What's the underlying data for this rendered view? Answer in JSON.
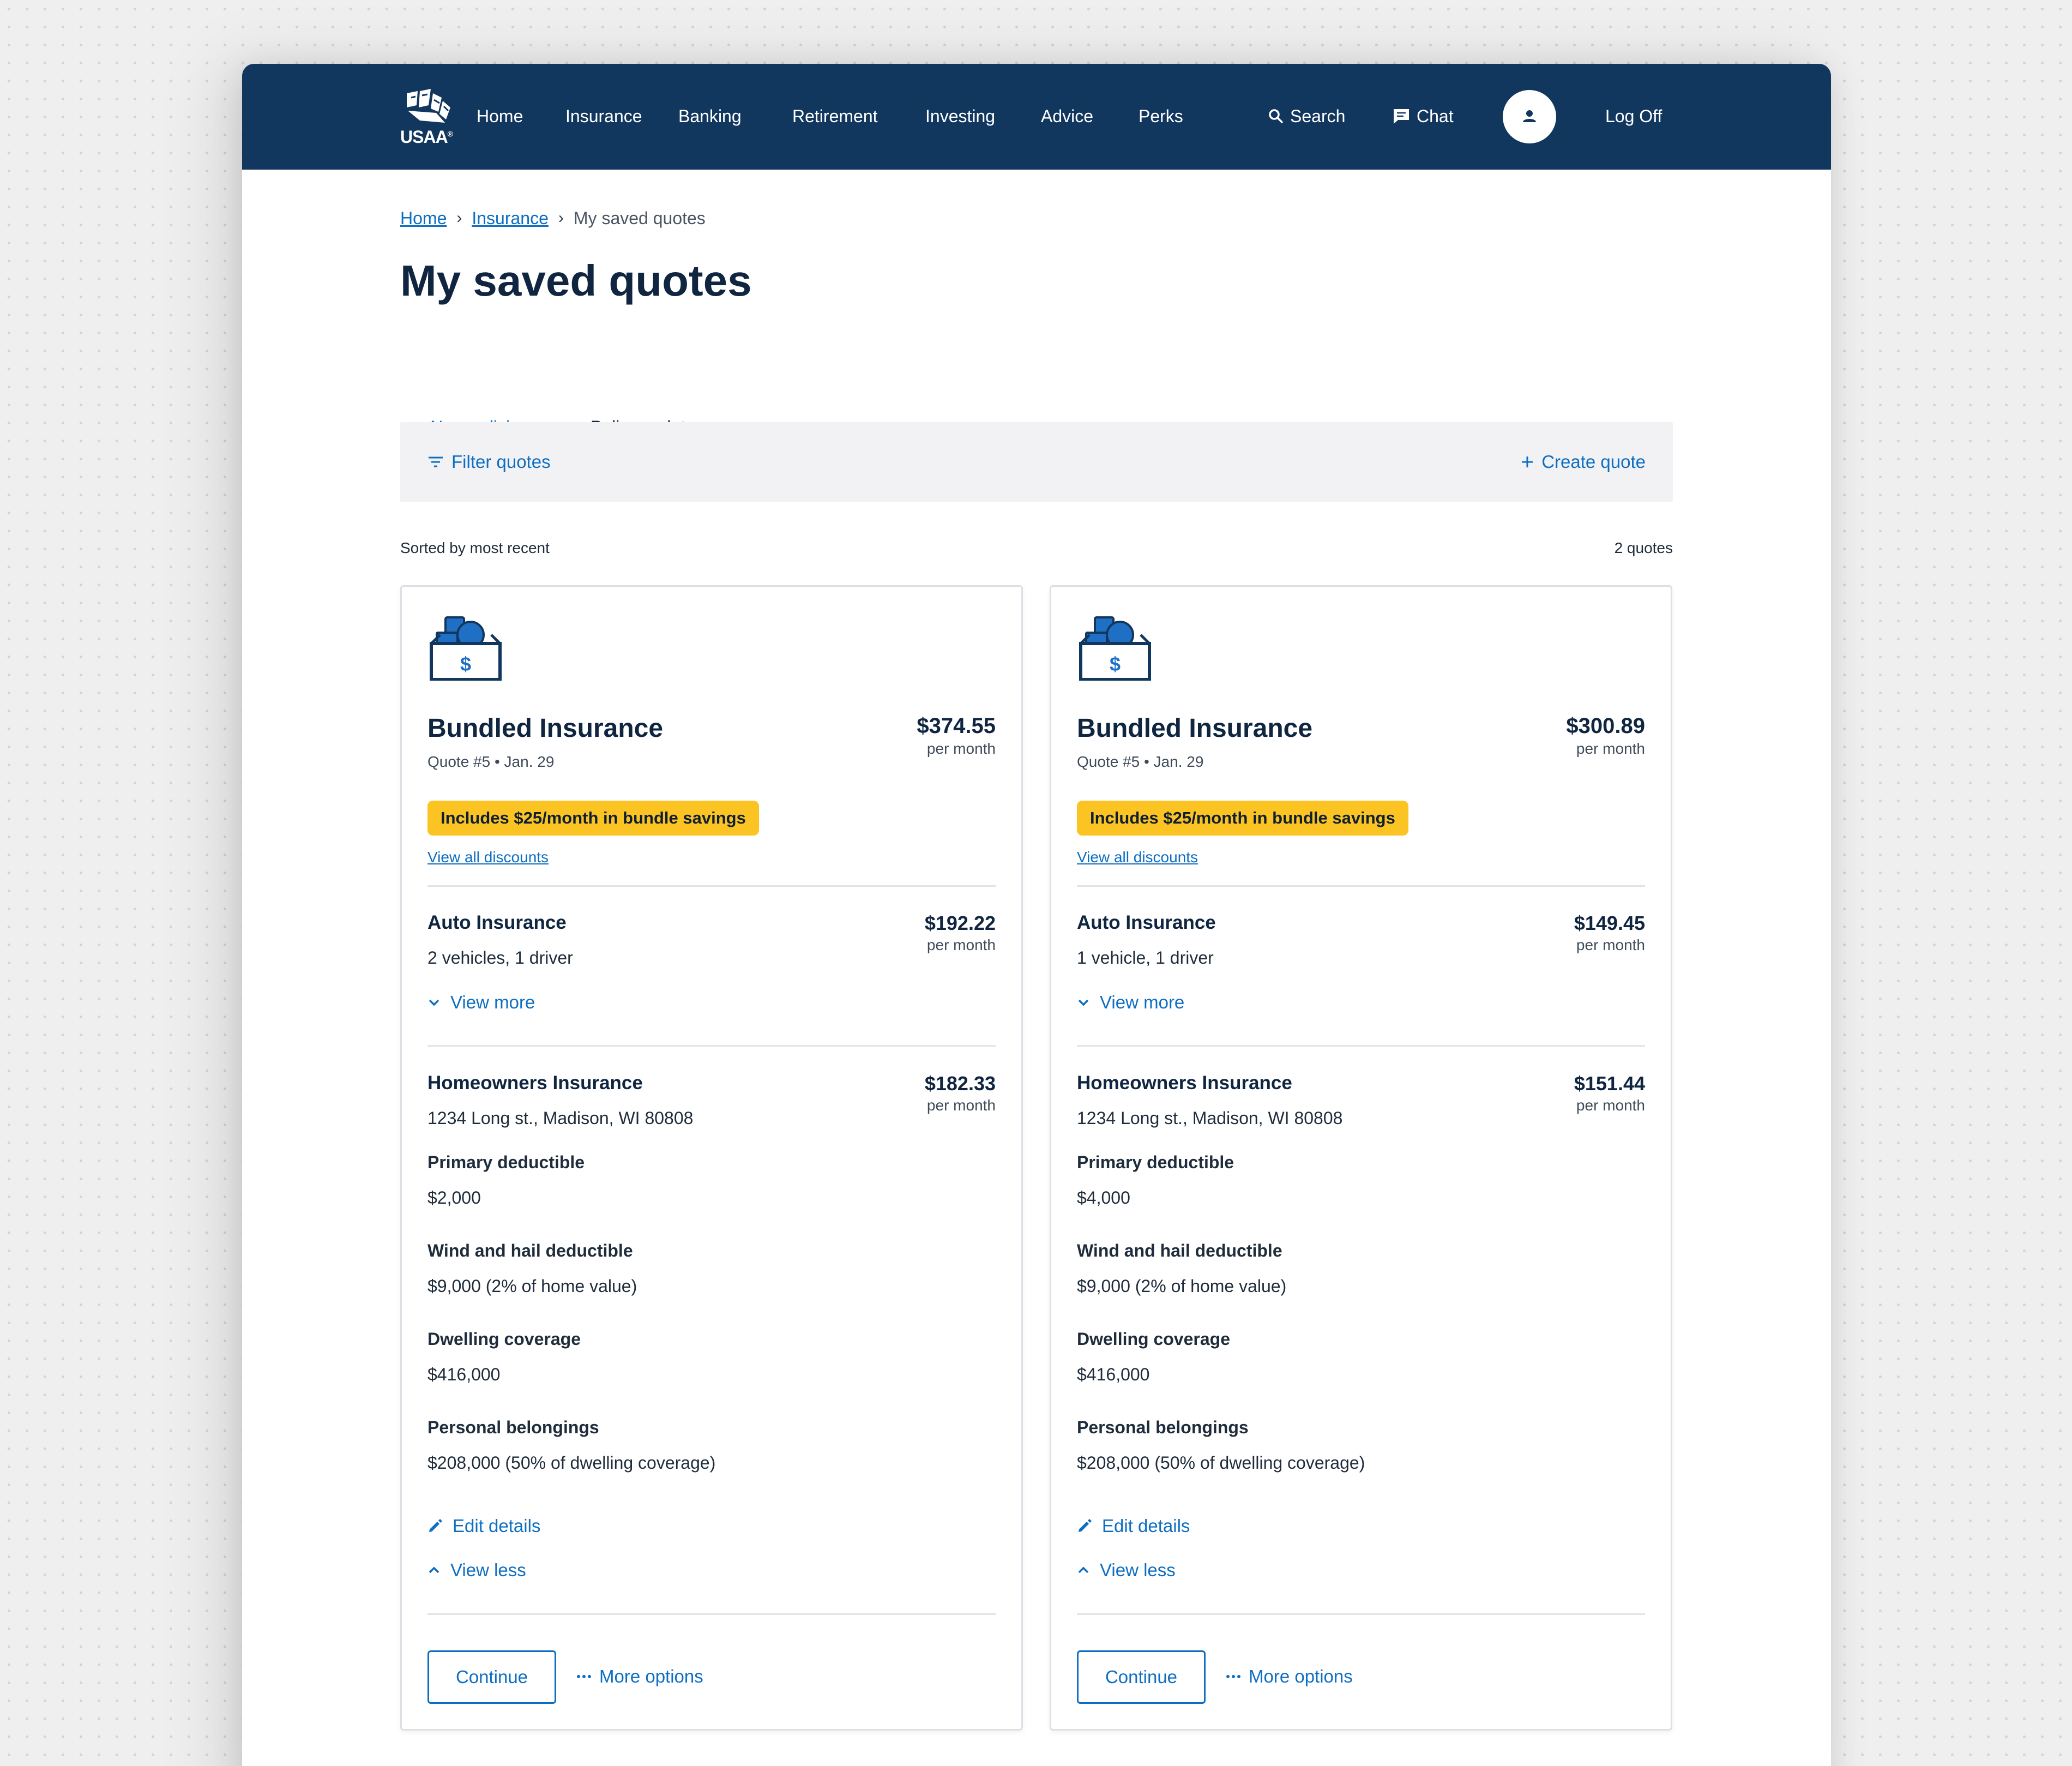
{
  "nav": {
    "logo": "USAA",
    "items": [
      "Home",
      "Insurance",
      "Banking",
      "Retirement",
      "Investing",
      "Advice",
      "Perks"
    ],
    "search": "Search",
    "chat": "Chat",
    "logoff": "Log Off"
  },
  "breadcrumb": {
    "home": "Home",
    "insurance": "Insurance",
    "current": "My saved quotes"
  },
  "page": {
    "title": "My saved quotes",
    "tabs": [
      "New policies",
      "Policy updates"
    ],
    "filter_label": "Filter quotes",
    "create_label": "Create quote",
    "sort_label": "Sorted by most recent",
    "count_label": "2 quotes"
  },
  "quotes": [
    {
      "title": "Bundled Insurance",
      "meta": "Quote #5  •  Jan. 29",
      "total": "$374.55",
      "per_month": "per month",
      "badge": "Includes $25/month in bundle savings",
      "discounts_link": "View all discounts",
      "auto": {
        "title": "Auto Insurance",
        "detail": "2 vehicles, 1 driver",
        "price": "$192.22",
        "view_more": "View more"
      },
      "home": {
        "title": "Homeowners Insurance",
        "address": "1234 Long st., Madison, WI 80808",
        "price": "$182.33",
        "fields": [
          {
            "label": "Primary deductible",
            "value": "$2,000"
          },
          {
            "label": "Wind and hail deductible",
            "value": "$9,000 (2% of home value)"
          },
          {
            "label": "Dwelling coverage",
            "value": "$416,000"
          },
          {
            "label": "Personal belongings",
            "value": "$208,000 (50% of dwelling coverage)"
          }
        ],
        "edit": "Edit details",
        "view_less": "View less"
      },
      "continue": "Continue",
      "more_options": "More options"
    },
    {
      "title": "Bundled Insurance",
      "meta": "Quote #5  •  Jan. 29",
      "total": "$300.89",
      "per_month": "per month",
      "badge": "Includes $25/month in bundle savings",
      "discounts_link": "View all discounts",
      "auto": {
        "title": "Auto Insurance",
        "detail": "1 vehicle, 1 driver",
        "price": "$149.45",
        "view_more": "View more"
      },
      "home": {
        "title": "Homeowners Insurance",
        "address": "1234 Long st., Madison, WI 80808",
        "price": "$151.44",
        "fields": [
          {
            "label": "Primary deductible",
            "value": "$4,000"
          },
          {
            "label": "Wind and hail deductible",
            "value": "$9,000 (2% of home value)"
          },
          {
            "label": "Dwelling coverage",
            "value": "$416,000"
          },
          {
            "label": "Personal belongings",
            "value": "$208,000 (50% of dwelling coverage)"
          }
        ],
        "edit": "Edit details",
        "view_less": "View less"
      },
      "continue": "Continue",
      "more_options": "More options"
    }
  ],
  "icons": {
    "logo": "eagle-logo-icon",
    "search": "search-icon",
    "chat": "chat-bubble-icon",
    "profile": "user-icon",
    "filter": "filter-icon",
    "create": "plus-icon",
    "bundle": "bundle-box-icon",
    "expand": "chevron-down-icon",
    "collapse": "chevron-up-icon",
    "edit": "pencil-icon",
    "more": "ellipsis-icon"
  },
  "colors": {
    "nav_background": "#12375f",
    "link": "#0d6ec2",
    "badge": "#fcc423",
    "text": "#0f2540"
  }
}
